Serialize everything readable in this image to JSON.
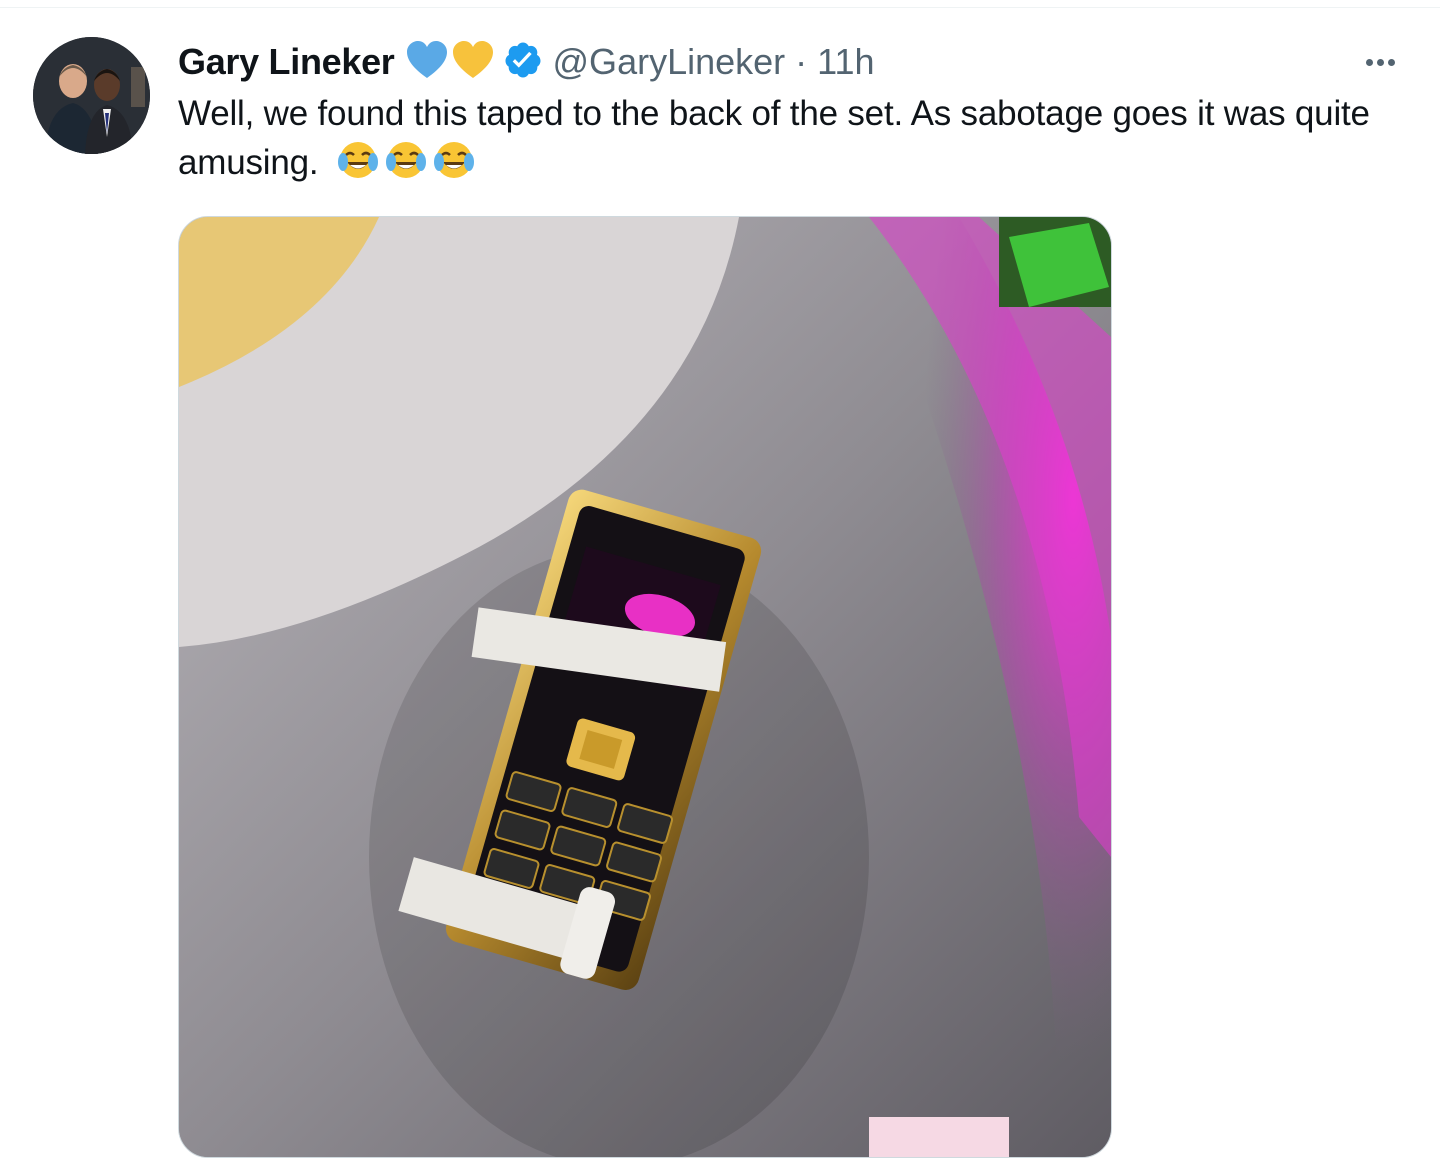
{
  "tweet": {
    "author": {
      "display_name": "Gary Lineker",
      "handle": "@GaryLineker",
      "badges": [
        "blue-heart-icon",
        "yellow-heart-icon",
        "verified-badge-icon"
      ]
    },
    "separator": "·",
    "timestamp": "11h",
    "text": "Well, we found this taped to the back of the set. As sabotage goes it was quite amusing.",
    "emojis": [
      "face-with-tears-of-joy",
      "face-with-tears-of-joy",
      "face-with-tears-of-joy"
    ],
    "more_icon": "more-horizontal-icon",
    "colors": {
      "verified": "#1d9bf0",
      "blue_heart": "#5aa9e6",
      "yellow_heart": "#f7c23c",
      "secondary_text": "#536471"
    }
  }
}
